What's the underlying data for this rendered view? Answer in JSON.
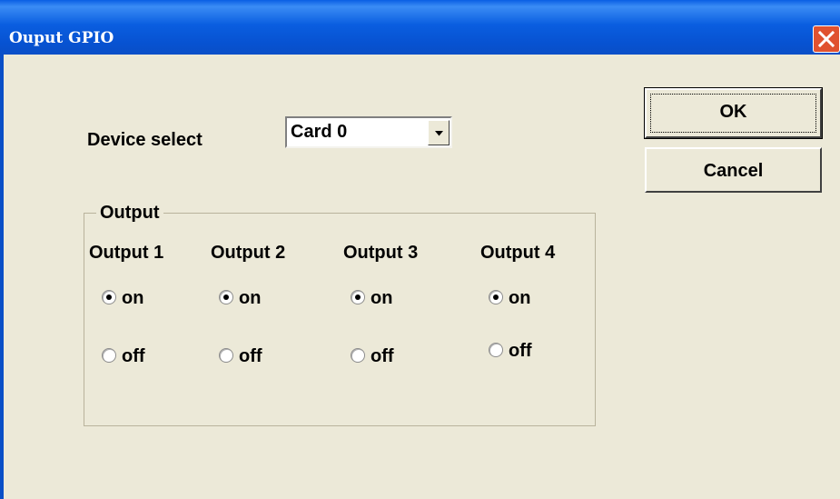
{
  "window": {
    "title": "Ouput GPIO"
  },
  "device": {
    "label": "Device select",
    "selected": "Card 0"
  },
  "buttons": {
    "ok": "OK",
    "cancel": "Cancel"
  },
  "output_group": {
    "title": "Output",
    "outputs": [
      {
        "label": "Output 1",
        "on_label": "on",
        "off_label": "off",
        "selected": "on"
      },
      {
        "label": "Output 2",
        "on_label": "on",
        "off_label": "off",
        "selected": "on"
      },
      {
        "label": "Output 3",
        "on_label": "on",
        "off_label": "off",
        "selected": "on"
      },
      {
        "label": "Output 4",
        "on_label": "on",
        "off_label": "off",
        "selected": "on"
      }
    ]
  }
}
